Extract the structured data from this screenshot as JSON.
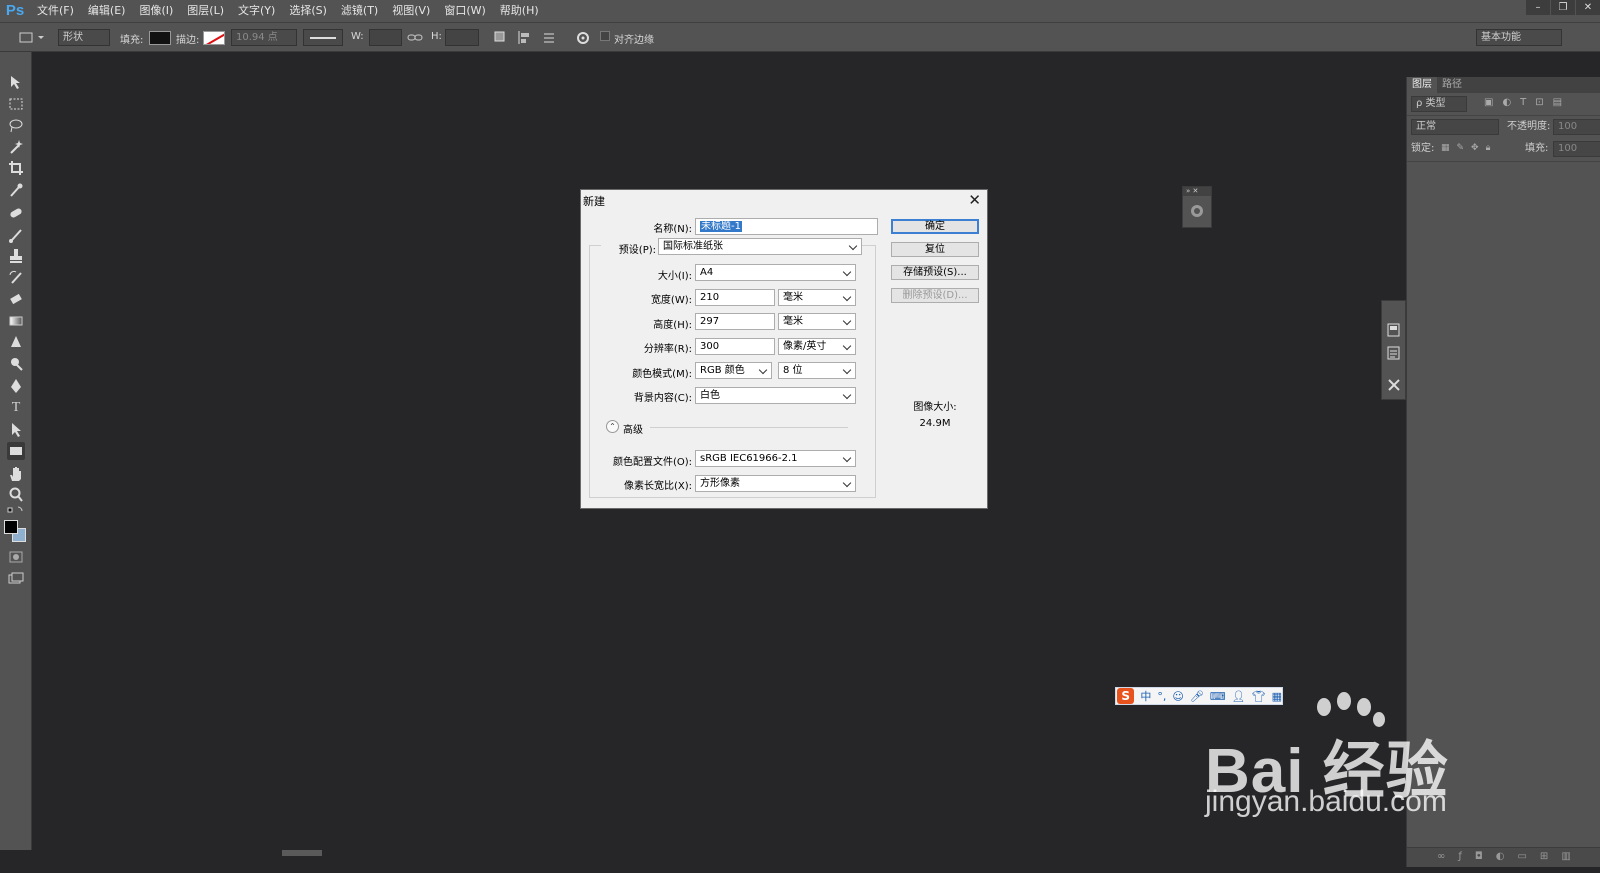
{
  "app": {
    "logo": "Ps"
  },
  "menu": [
    "文件(F)",
    "编辑(E)",
    "图像(I)",
    "图层(L)",
    "文字(Y)",
    "选择(S)",
    "滤镜(T)",
    "视图(V)",
    "窗口(W)",
    "帮助(H)"
  ],
  "window_controls": {
    "minimize": "–",
    "restore": "❐",
    "close": "✕"
  },
  "options_bar": {
    "mode_select": "形状",
    "fill_label": "填充:",
    "stroke_label": "描边:",
    "stroke_width": "10.94 点",
    "width_label": "W:",
    "height_label": "H:",
    "align_edges_label": "对齐边缘",
    "workspace_select": "基本功能"
  },
  "right_panel": {
    "tabs": [
      "图层",
      "路径"
    ],
    "filter_select": "ρ 类型",
    "blend_mode": "正常",
    "opacity_label": "不透明度:",
    "opacity_value": "100",
    "lock_label": "锁定:",
    "fill_label": "填充:",
    "fill_value": "100"
  },
  "dialog": {
    "title": "新建",
    "name_label": "名称(N):",
    "name_value": "未标题-1",
    "preset_label": "预设(P):",
    "preset_value": "国际标准纸张",
    "size_label": "大小(I):",
    "size_value": "A4",
    "width_label": "宽度(W):",
    "width_value": "210",
    "width_unit": "毫米",
    "height_label": "高度(H):",
    "height_value": "297",
    "height_unit": "毫米",
    "resolution_label": "分辨率(R):",
    "resolution_value": "300",
    "resolution_unit": "像素/英寸",
    "color_mode_label": "颜色模式(M):",
    "color_mode_value": "RGB 颜色",
    "bit_depth_value": "8 位",
    "background_label": "背景内容(C):",
    "background_value": "白色",
    "advanced_label": "高级",
    "profile_label": "颜色配置文件(O):",
    "profile_value": "sRGB IEC61966-2.1",
    "aspect_label": "像素长宽比(X):",
    "aspect_value": "方形像素",
    "ok_button": "确定",
    "reset_button": "复位",
    "save_preset_button": "存储预设(S)...",
    "delete_preset_button": "删除预设(D)...",
    "image_size_label": "图像大小:",
    "image_size_value": "24.9M"
  },
  "ime": {
    "logo": "S",
    "mode": "中"
  },
  "watermark": {
    "brand": "Bai  经验",
    "url": "jingyan.baidu.com"
  }
}
